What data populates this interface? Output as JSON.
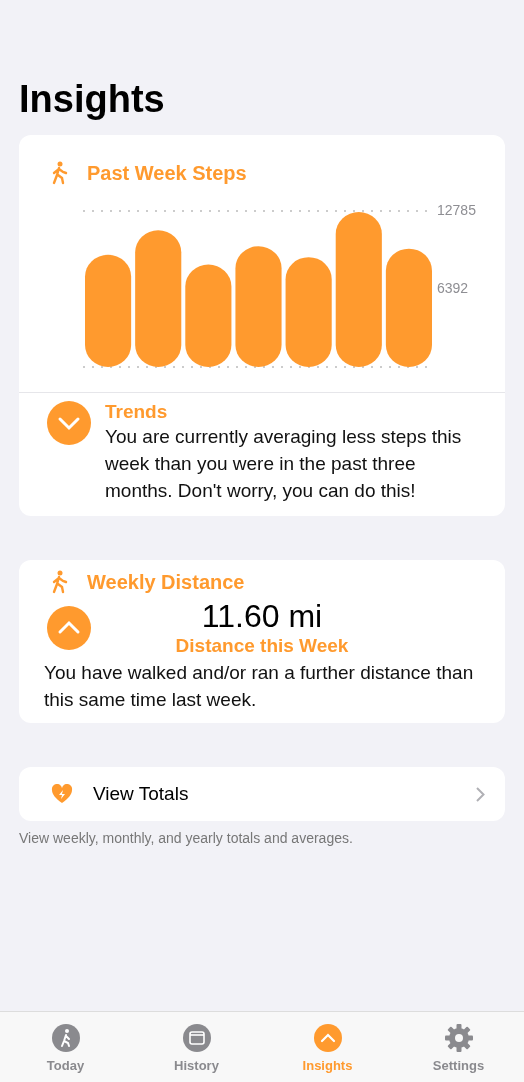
{
  "title": "Insights",
  "steps_card": {
    "title": "Past Week Steps",
    "chart_data": {
      "type": "bar",
      "values": [
        9200,
        11200,
        8400,
        9900,
        9000,
        12700,
        9700
      ],
      "ylim": [
        0,
        12785
      ],
      "yticks": [
        6392,
        12785
      ]
    },
    "trend": {
      "up": false,
      "title": "Trends",
      "text": "You are currently averaging less steps this week than you were in the past three months. Don't worry, you can do this!"
    }
  },
  "distance_card": {
    "title": "Weekly Distance",
    "up": true,
    "value": "11.60 mi",
    "caption": "Distance this Week",
    "text": "You have walked and/or ran a further distance than this same time last week."
  },
  "totals": {
    "label": "View Totals",
    "footer": "View weekly, monthly, and yearly totals and averages."
  },
  "tabs": [
    {
      "kind": "today",
      "label": "Today",
      "selected": false
    },
    {
      "kind": "history",
      "label": "History",
      "selected": false
    },
    {
      "kind": "insights",
      "label": "Insights",
      "selected": true
    },
    {
      "kind": "settings",
      "label": "Settings",
      "selected": false
    }
  ]
}
